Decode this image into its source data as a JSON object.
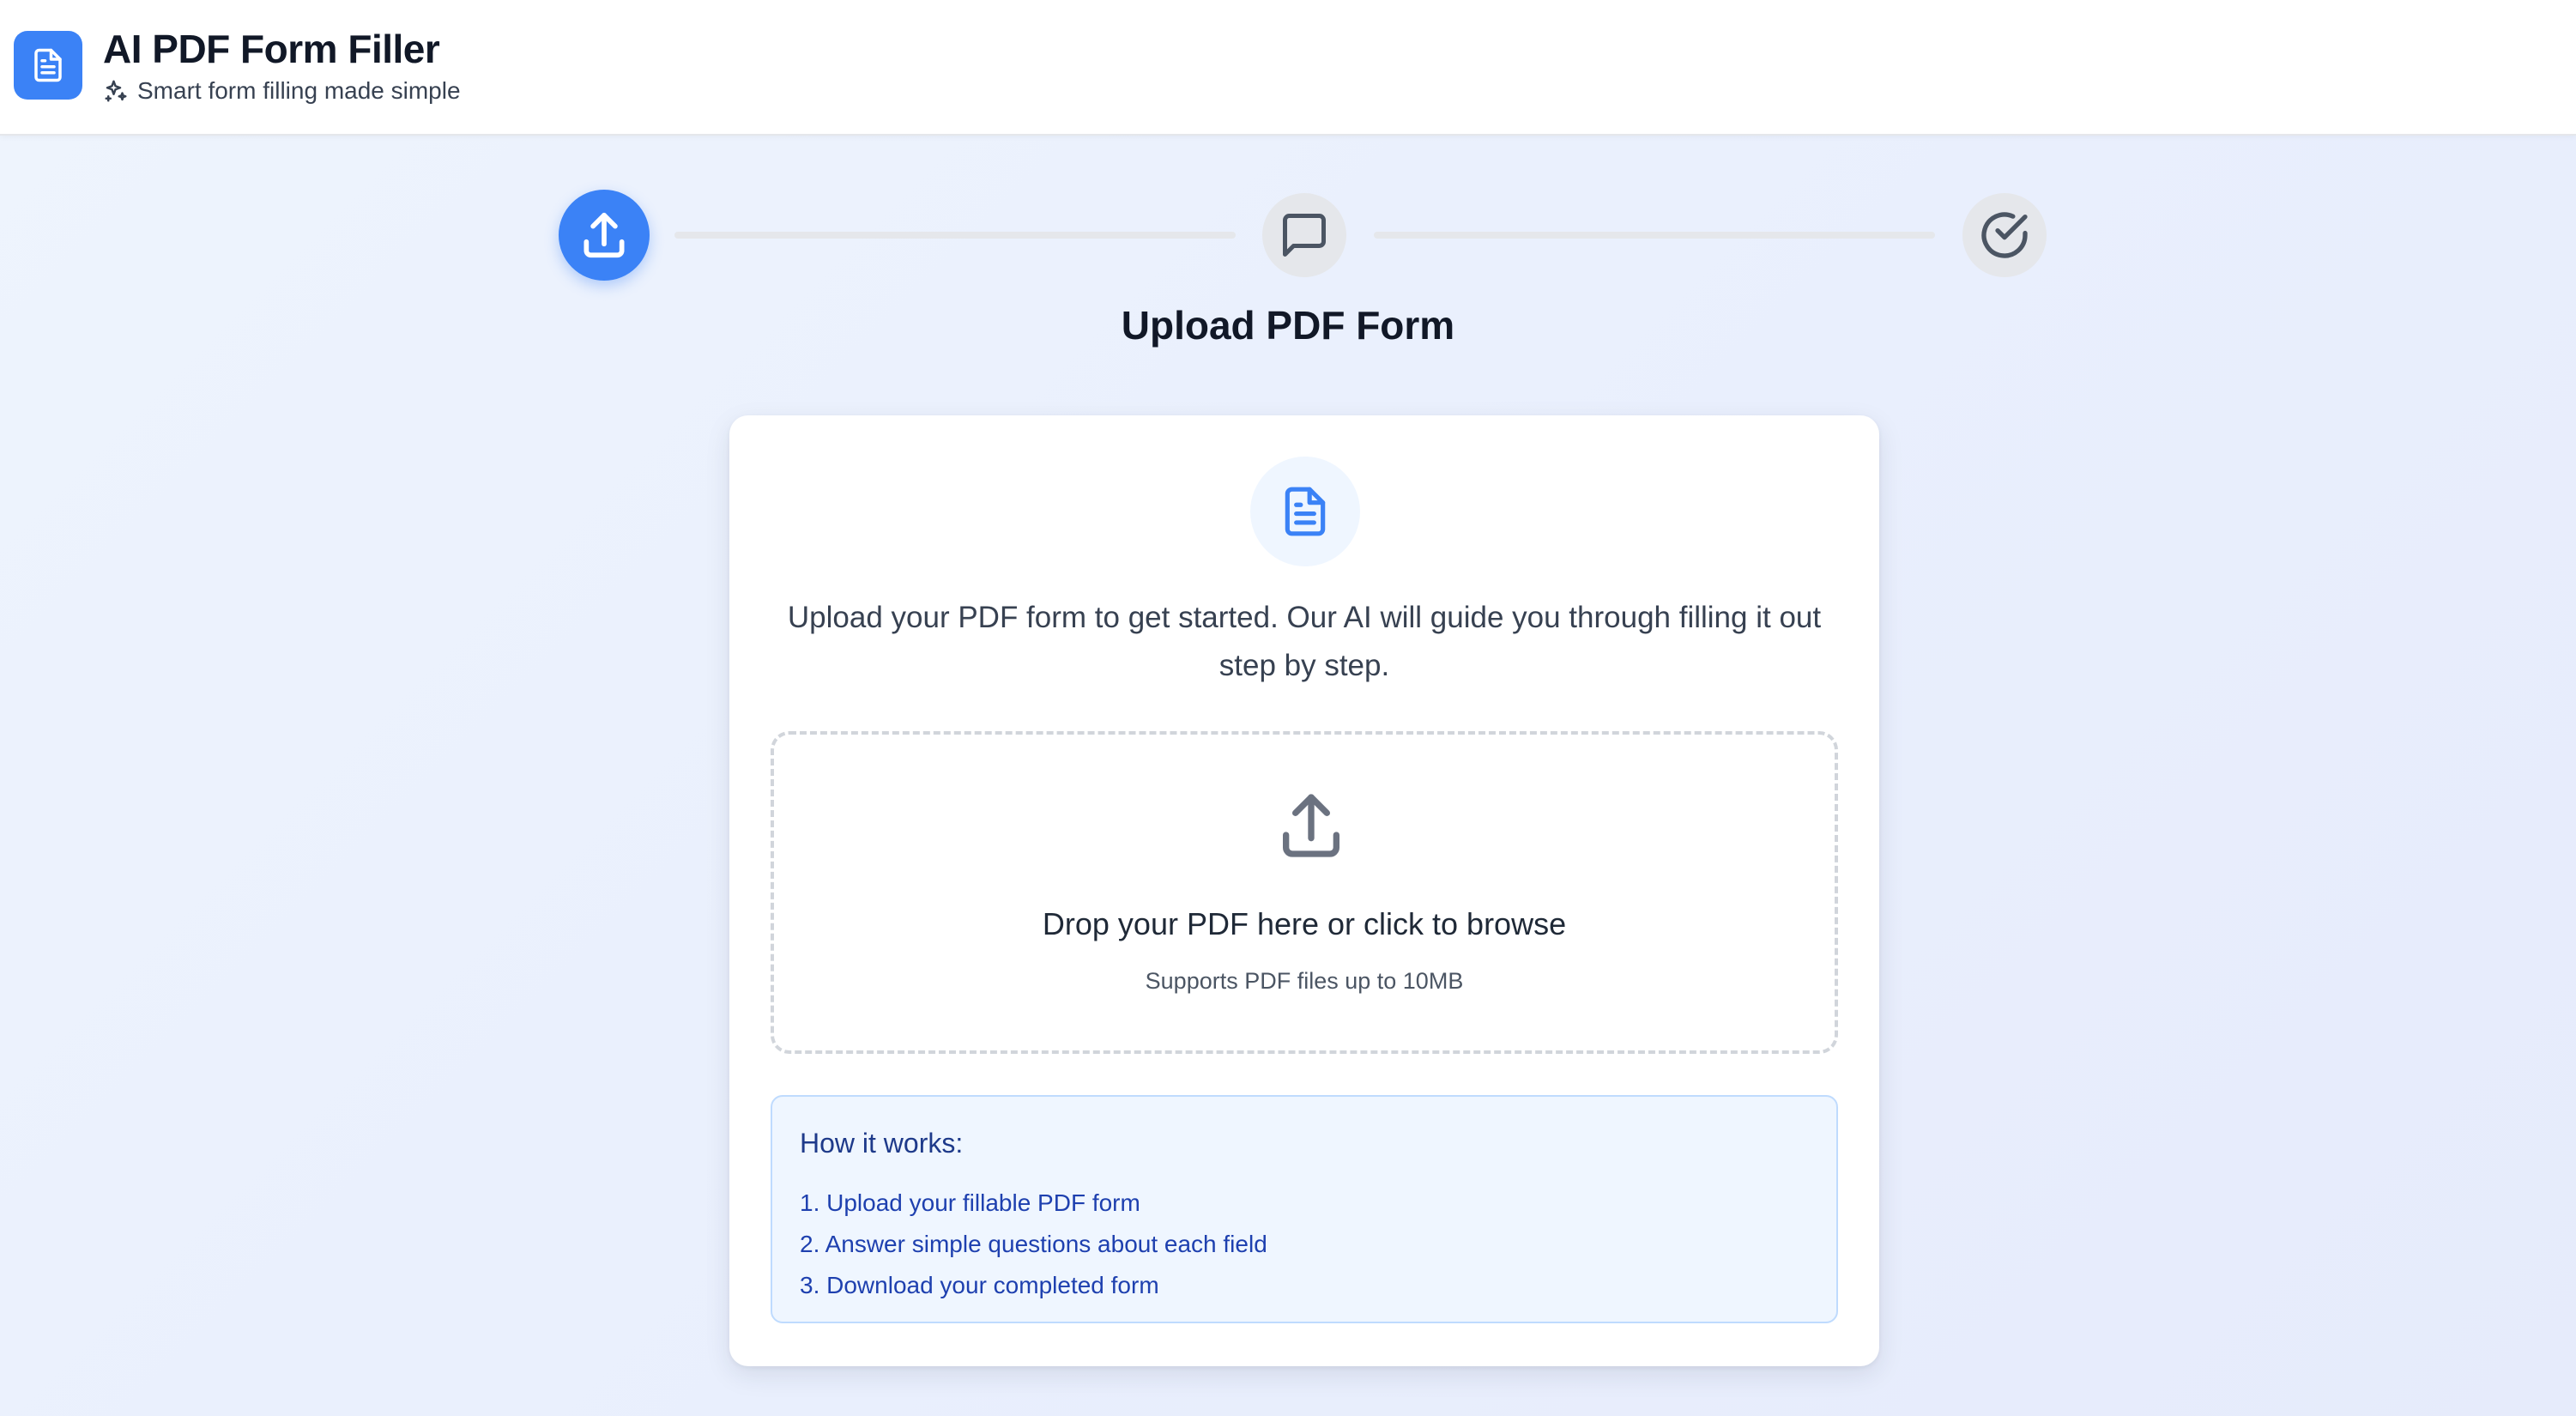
{
  "header": {
    "title": "AI PDF Form Filler",
    "subtitle": "Smart form filling made simple",
    "logo_icon": "document-icon",
    "subtitle_icon": "sparkles-icon"
  },
  "stepper": {
    "steps": [
      {
        "icon": "upload-icon",
        "state": "active"
      },
      {
        "icon": "message-icon",
        "state": "inactive"
      },
      {
        "icon": "check-circle-icon",
        "state": "inactive"
      }
    ]
  },
  "main": {
    "title": "Upload PDF Form",
    "intro": "Upload your PDF form to get started. Our AI will guide you through filling it out step by step.",
    "card_icon": "document-icon"
  },
  "dropzone": {
    "icon": "upload-icon",
    "title": "Drop your PDF here or click to browse",
    "hint": "Supports PDF files up to 10MB"
  },
  "how_it_works": {
    "title": "How it works:",
    "steps": [
      "1. Upload your fillable PDF form",
      "2. Answer simple questions about each field",
      "3. Download your completed form"
    ]
  },
  "colors": {
    "accent": "#3b82f6",
    "inactive_step": "#e5e7eb",
    "info_text": "#1e40af",
    "info_bg": "#eff6ff"
  }
}
